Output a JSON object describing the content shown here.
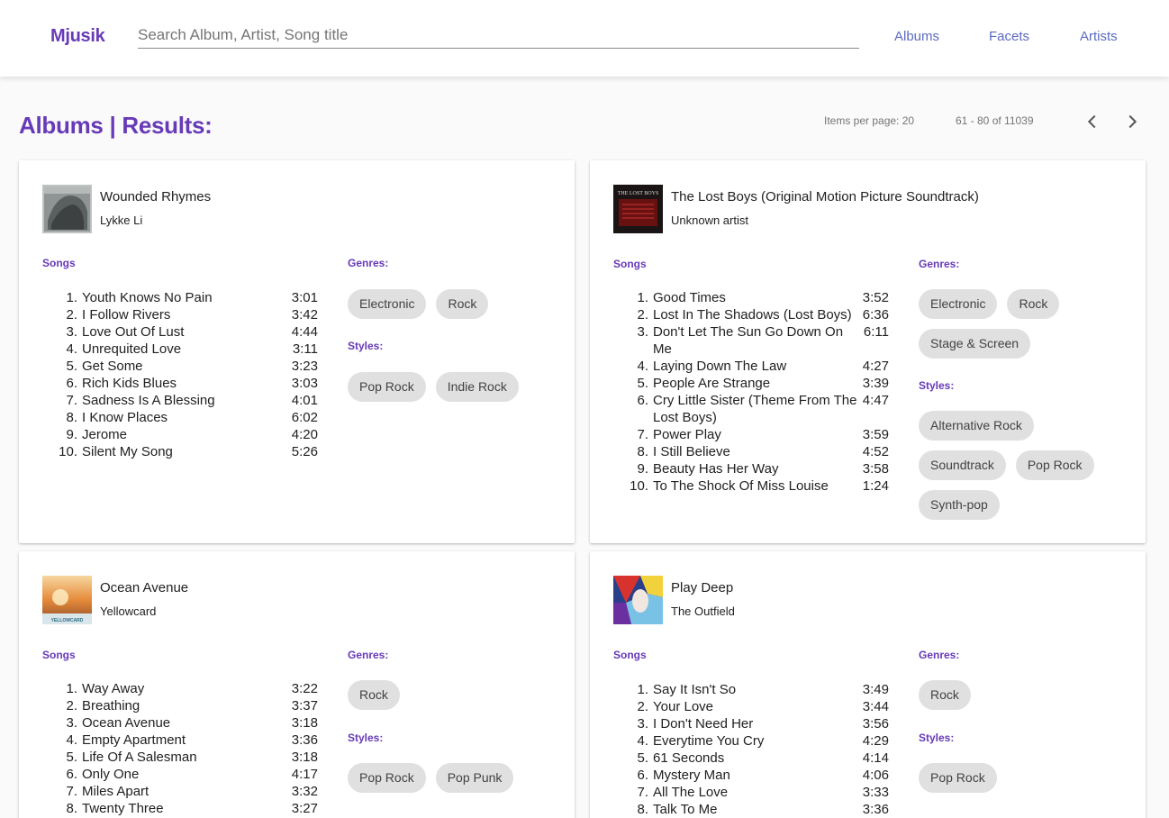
{
  "app": {
    "brand": "Mjusik"
  },
  "search": {
    "placeholder": "Search Album, Artist, Song title"
  },
  "nav": [
    "Albums",
    "Facets",
    "Artists"
  ],
  "page": {
    "title": "Albums | Results:"
  },
  "pager": {
    "items_per_page": "Items per page: 20",
    "range": "61 - 80 of 11039"
  },
  "labels": {
    "songs": "Songs",
    "genres": "Genres:",
    "styles": "Styles:"
  },
  "albums": [
    {
      "title": "Wounded Rhymes",
      "artist": "Lykke Li",
      "songs": [
        {
          "n": "1.",
          "title": "Youth Knows No Pain",
          "dur": "3:01"
        },
        {
          "n": "2.",
          "title": "I Follow Rivers",
          "dur": "3:42"
        },
        {
          "n": "3.",
          "title": "Love Out Of Lust",
          "dur": "4:44"
        },
        {
          "n": "4.",
          "title": "Unrequited Love",
          "dur": "3:11"
        },
        {
          "n": "5.",
          "title": "Get Some",
          "dur": "3:23"
        },
        {
          "n": "6.",
          "title": "Rich Kids Blues",
          "dur": "3:03"
        },
        {
          "n": "7.",
          "title": "Sadness Is A Blessing",
          "dur": "4:01"
        },
        {
          "n": "8.",
          "title": "I Know Places",
          "dur": "6:02"
        },
        {
          "n": "9.",
          "title": "Jerome",
          "dur": "4:20"
        },
        {
          "n": "10.",
          "title": "Silent My Song",
          "dur": "5:26"
        }
      ],
      "genres": [
        "Electronic",
        "Rock"
      ],
      "styles": [
        "Pop Rock",
        "Indie Rock"
      ]
    },
    {
      "title": "The Lost Boys (Original Motion Picture Soundtrack)",
      "artist": "Unknown artist",
      "cover_text": "THE LOST BOYS",
      "songs": [
        {
          "n": "1.",
          "title": "Good Times",
          "dur": "3:52"
        },
        {
          "n": "2.",
          "title": "Lost In The Shadows (Lost Boys)",
          "dur": "6:36"
        },
        {
          "n": "3.",
          "title": "Don't Let The Sun Go Down On Me",
          "dur": "6:11"
        },
        {
          "n": "4.",
          "title": "Laying Down The Law",
          "dur": "4:27"
        },
        {
          "n": "5.",
          "title": "People Are Strange",
          "dur": "3:39"
        },
        {
          "n": "6.",
          "title": "Cry Little Sister (Theme From The Lost Boys)",
          "dur": "4:47"
        },
        {
          "n": "7.",
          "title": "Power Play",
          "dur": "3:59"
        },
        {
          "n": "8.",
          "title": "I Still Believe",
          "dur": "4:52"
        },
        {
          "n": "9.",
          "title": "Beauty Has Her Way",
          "dur": "3:58"
        },
        {
          "n": "10.",
          "title": "To The Shock Of Miss Louise",
          "dur": "1:24"
        }
      ],
      "genres": [
        "Electronic",
        "Rock",
        "Stage & Screen"
      ],
      "styles": [
        "Alternative Rock",
        "Soundtrack",
        "Pop Rock",
        "Synth-pop"
      ]
    },
    {
      "title": "Ocean Avenue",
      "artist": "Yellowcard",
      "cover_text": "YELLOWCARD",
      "songs": [
        {
          "n": "1.",
          "title": "Way Away",
          "dur": "3:22"
        },
        {
          "n": "2.",
          "title": "Breathing",
          "dur": "3:37"
        },
        {
          "n": "3.",
          "title": "Ocean Avenue",
          "dur": "3:18"
        },
        {
          "n": "4.",
          "title": "Empty Apartment",
          "dur": "3:36"
        },
        {
          "n": "5.",
          "title": "Life Of A Salesman",
          "dur": "3:18"
        },
        {
          "n": "6.",
          "title": "Only One",
          "dur": "4:17"
        },
        {
          "n": "7.",
          "title": "Miles Apart",
          "dur": "3:32"
        },
        {
          "n": "8.",
          "title": "Twenty Three",
          "dur": "3:27"
        }
      ],
      "genres": [
        "Rock"
      ],
      "styles": [
        "Pop Rock",
        "Pop Punk"
      ]
    },
    {
      "title": "Play Deep",
      "artist": "The Outfield",
      "songs": [
        {
          "n": "1.",
          "title": "Say It Isn't So",
          "dur": "3:49"
        },
        {
          "n": "2.",
          "title": "Your Love",
          "dur": "3:44"
        },
        {
          "n": "3.",
          "title": "I Don't Need Her",
          "dur": "3:56"
        },
        {
          "n": "4.",
          "title": "Everytime You Cry",
          "dur": "4:29"
        },
        {
          "n": "5.",
          "title": "61 Seconds",
          "dur": "4:14"
        },
        {
          "n": "6.",
          "title": "Mystery Man",
          "dur": "4:06"
        },
        {
          "n": "7.",
          "title": "All The Love",
          "dur": "3:33"
        },
        {
          "n": "8.",
          "title": "Talk To Me",
          "dur": "3:36"
        }
      ],
      "genres": [
        "Rock"
      ],
      "styles": [
        "Pop Rock"
      ]
    }
  ],
  "colors": {
    "accent": "#673ab7",
    "nav_link": "#5c6bc0",
    "chip_bg": "#e0e0e0"
  },
  "icons": {
    "prev": "chevron-left-icon",
    "next": "chevron-right-icon"
  }
}
